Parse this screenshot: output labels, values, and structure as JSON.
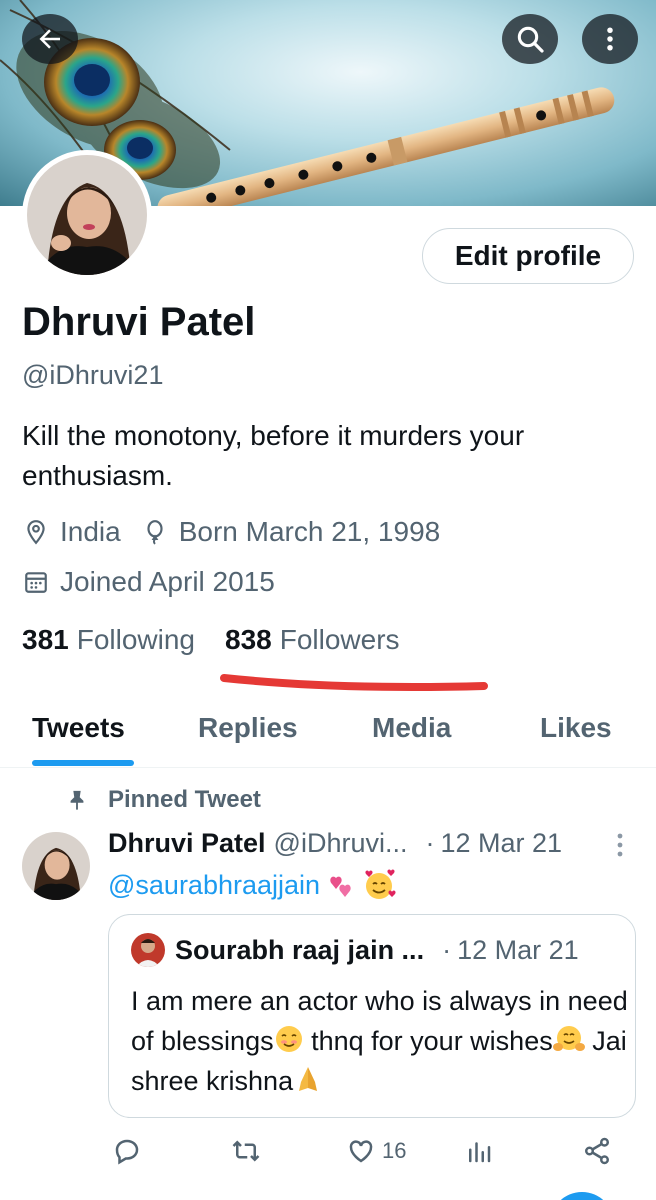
{
  "header": {
    "back_icon": "arrow-left-icon",
    "search_icon": "search-icon",
    "more_icon": "more-vertical-icon"
  },
  "profile": {
    "edit_label": "Edit profile",
    "name": "Dhruvi Patel",
    "handle": "@iDhruvi21",
    "bio": "Kill the monotony, before it murders your enthusiasm.",
    "location": "India",
    "birthday": "Born March 21, 1998",
    "joined": "Joined April 2015",
    "following_count": "381",
    "following_label": "Following",
    "followers_count": "838",
    "followers_label": "Followers"
  },
  "tabs": [
    {
      "label": "Tweets",
      "active": true
    },
    {
      "label": "Replies",
      "active": false
    },
    {
      "label": "Media",
      "active": false
    },
    {
      "label": "Likes",
      "active": false
    }
  ],
  "pinned_tweet": {
    "pinned_label": "Pinned Tweet",
    "author_name": "Dhruvi Patel",
    "author_handle": "@iDhruvi...",
    "dot": "·",
    "date": "12 Mar 21",
    "mention": "@saurabhraajjain",
    "quote": {
      "author_name": "Sourabh raaj jain ...",
      "dot": "·",
      "date": "12 Mar 21",
      "text_part1": "I am mere an actor who is always in need of blessings",
      "text_part2": " thnq for your wishes",
      "text_part3": " Jai shree krishna"
    },
    "actions": {
      "reply_icon": "reply-icon",
      "retweet_icon": "retweet-icon",
      "like_icon": "heart-icon",
      "like_count": "16",
      "views_icon": "analytics-icon",
      "share_icon": "share-icon"
    }
  },
  "colors": {
    "accent": "#1d9bf0",
    "text_primary": "#0f1419",
    "text_secondary": "#536471",
    "annotation_red": "#e53935"
  }
}
